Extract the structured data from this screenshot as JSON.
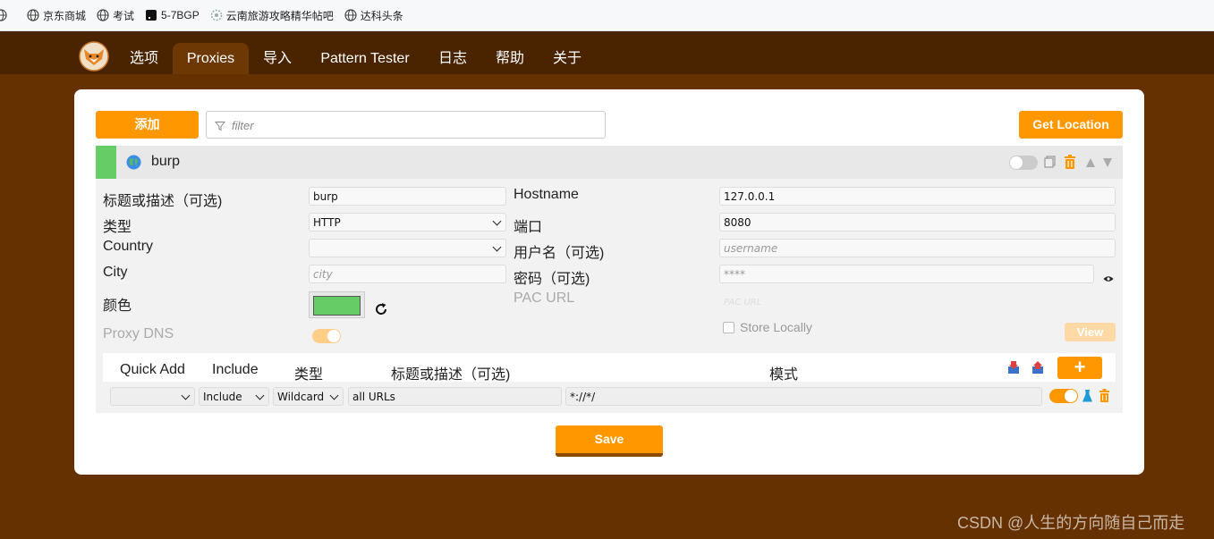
{
  "bookmarks": [
    {
      "label": "京东商城",
      "icon": "globe-icon"
    },
    {
      "label": "考试",
      "icon": "globe-icon"
    },
    {
      "label": "5-7BGP",
      "icon": "terminal-icon"
    },
    {
      "label": "云南旅游攻略精华帖吧",
      "icon": "forum-icon"
    },
    {
      "label": "达科头条",
      "icon": "globe-icon"
    }
  ],
  "nav": {
    "items": [
      "选项",
      "Proxies",
      "导入",
      "Pattern Tester",
      "日志",
      "帮助",
      "关于"
    ],
    "active": "Proxies"
  },
  "toolbar": {
    "add_label": "添加",
    "filter_placeholder": "filter",
    "get_location_label": "Get Location"
  },
  "proxy": {
    "name": "burp",
    "color": "#66cc66",
    "enabled": false,
    "fields": {
      "title_label": "标题或描述（可选)",
      "title_value": "burp",
      "type_label": "类型",
      "type_value": "HTTP",
      "country_label": "Country",
      "country_value": "",
      "city_label": "City",
      "city_placeholder": "city",
      "color_label": "颜色",
      "proxy_dns_label": "Proxy DNS",
      "hostname_label": "Hostname",
      "hostname_value": "127.0.0.1",
      "port_label": "端口",
      "port_value": "8080",
      "username_label": "用户名（可选)",
      "username_placeholder": "username",
      "password_label": "密码（可选)",
      "password_placeholder": "****",
      "pac_url_label": "PAC URL",
      "pac_url_placeholder": "PAC URL",
      "store_locally_label": "Store Locally",
      "view_label": "View"
    }
  },
  "patterns": {
    "headers": {
      "quick_add": "Quick Add",
      "include": "Include",
      "type": "类型",
      "title": "标题或描述（可选)",
      "pattern": "模式"
    },
    "add_label": "+",
    "rows": [
      {
        "quick_add": "",
        "include": "Include",
        "type": "Wildcard",
        "title": "all URLs",
        "pattern": "*://*/",
        "enabled": true
      }
    ]
  },
  "save_label": "Save",
  "watermark": "CSDN @人生的方向随自己而走",
  "colors": {
    "accent": "#ff9800",
    "nav_bg": "#4a2300",
    "page_bg": "#663100",
    "proxy_color": "#66cc66"
  }
}
